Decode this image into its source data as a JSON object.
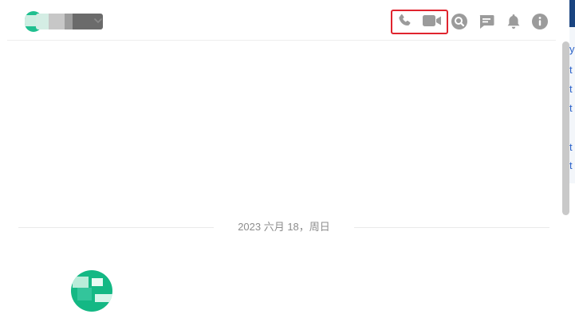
{
  "header": {
    "room_name": "",
    "actions": [
      {
        "name": "voice-call-button",
        "icon": "phone-icon"
      },
      {
        "name": "video-call-button",
        "icon": "video-camera-icon"
      },
      {
        "name": "search-button",
        "icon": "search-icon"
      },
      {
        "name": "threads-button",
        "icon": "message-icon"
      },
      {
        "name": "notifications-button",
        "icon": "bell-icon"
      },
      {
        "name": "room-info-button",
        "icon": "info-icon"
      }
    ]
  },
  "timeline": {
    "date_separator": "2023 六月 18，周日"
  },
  "side_panel": {
    "clipped_chars": [
      "y",
      "t",
      "t",
      "t",
      "t",
      "t"
    ]
  },
  "colors": {
    "icon": "#9b9b9b",
    "highlight": "#e0242e",
    "avatar": "#14b884",
    "link": "#2b62c8"
  }
}
